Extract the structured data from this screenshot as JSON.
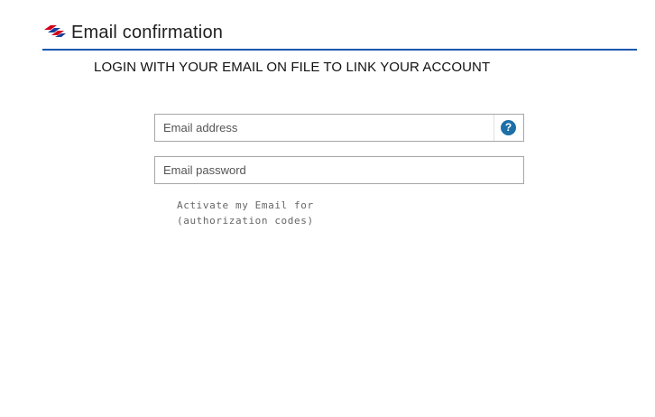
{
  "header": {
    "logo_icon": "bank-flag-logo-icon",
    "title": "Email confirmation",
    "accent_color": "#1a56b0"
  },
  "instruction": "LOGIN WITH YOUR EMAIL ON FILE TO LINK YOUR ACCOUNT",
  "form": {
    "email": {
      "placeholder": "Email address",
      "value": ""
    },
    "help_icon": "question-circle-icon",
    "help_glyph": "?",
    "password": {
      "placeholder": "Email password",
      "value": ""
    },
    "note_lines": [
      "Activate my Email for",
      "(authorization codes)"
    ]
  }
}
